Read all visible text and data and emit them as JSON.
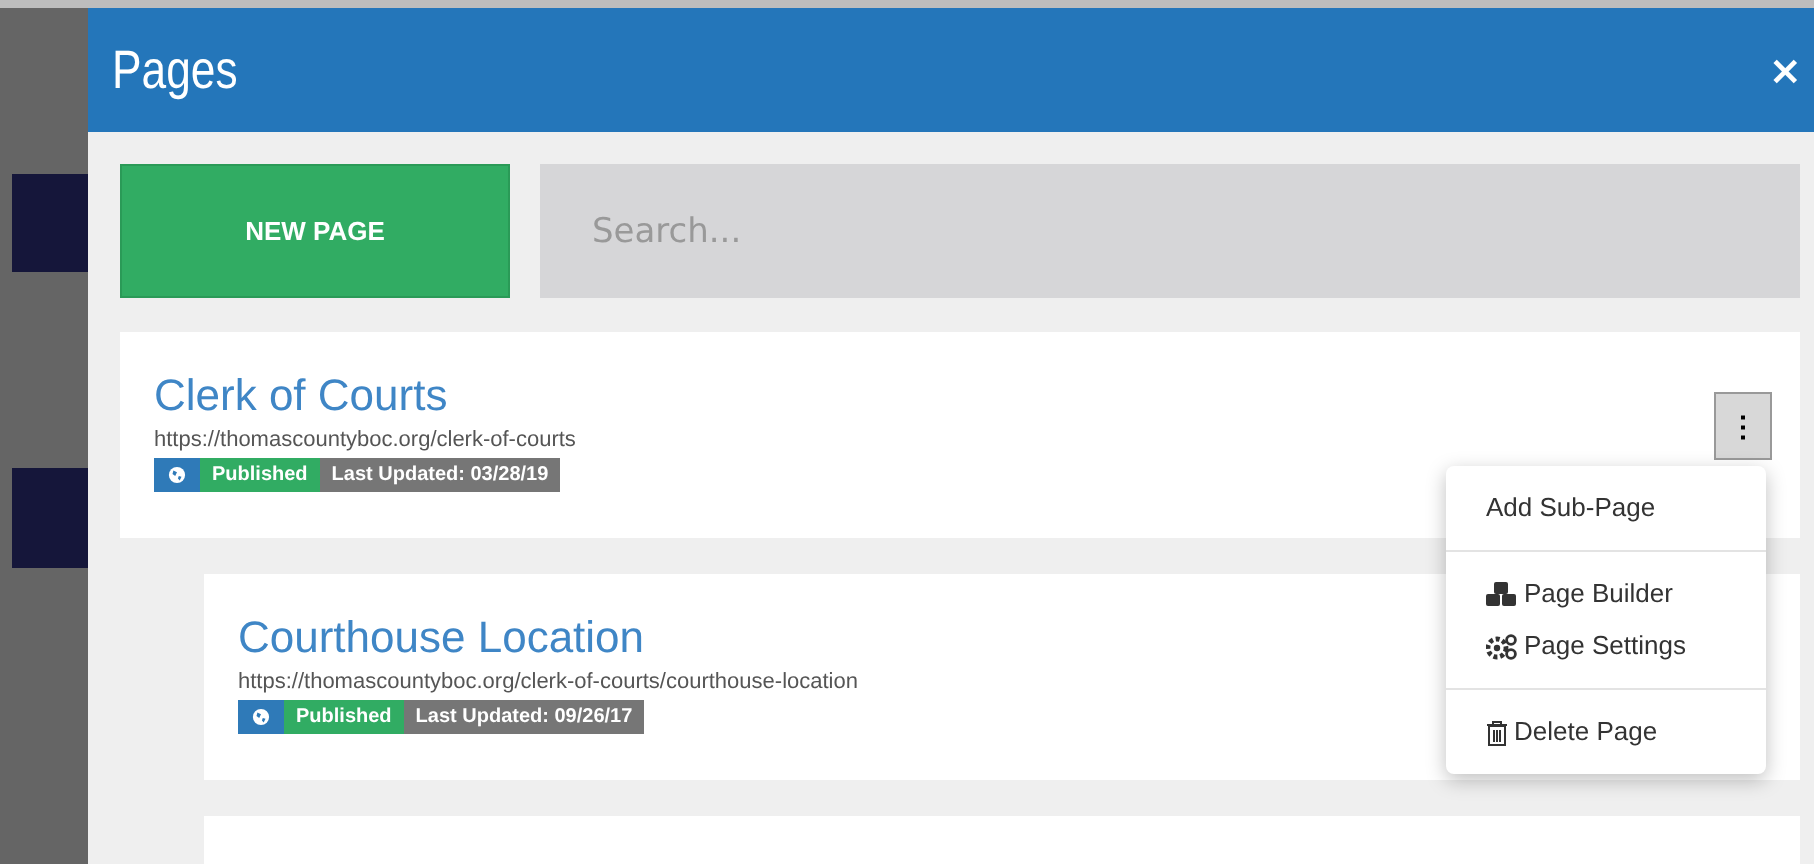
{
  "window": {
    "title": "Pages",
    "close": "×"
  },
  "toolbar": {
    "new_button": "NEW PAGE",
    "search": {
      "placeholder": "Search..."
    }
  },
  "pages": [
    {
      "title": "Clerk of Courts",
      "url": "https://thomascountyboc.org/clerk-of-courts",
      "status": "Published",
      "updated": "Last Updated: 03/28/19",
      "nested": false,
      "menu_button": "⋮"
    },
    {
      "title": "Courthouse Location",
      "url": "https://thomascountyboc.org/clerk-of-courts/courthouse-location",
      "status": "Published",
      "updated": "Last Updated: 09/26/17",
      "nested": true
    },
    {
      "nested": true
    }
  ],
  "menu": {
    "groups": [
      [
        {
          "kind": "plain",
          "label": "Add Sub-Page"
        }
      ],
      [
        {
          "kind": "builder",
          "label": "Page Builder"
        },
        {
          "kind": "settings",
          "label": "Page Settings"
        }
      ],
      [
        {
          "kind": "delete",
          "label": "Delete Page"
        }
      ]
    ]
  }
}
